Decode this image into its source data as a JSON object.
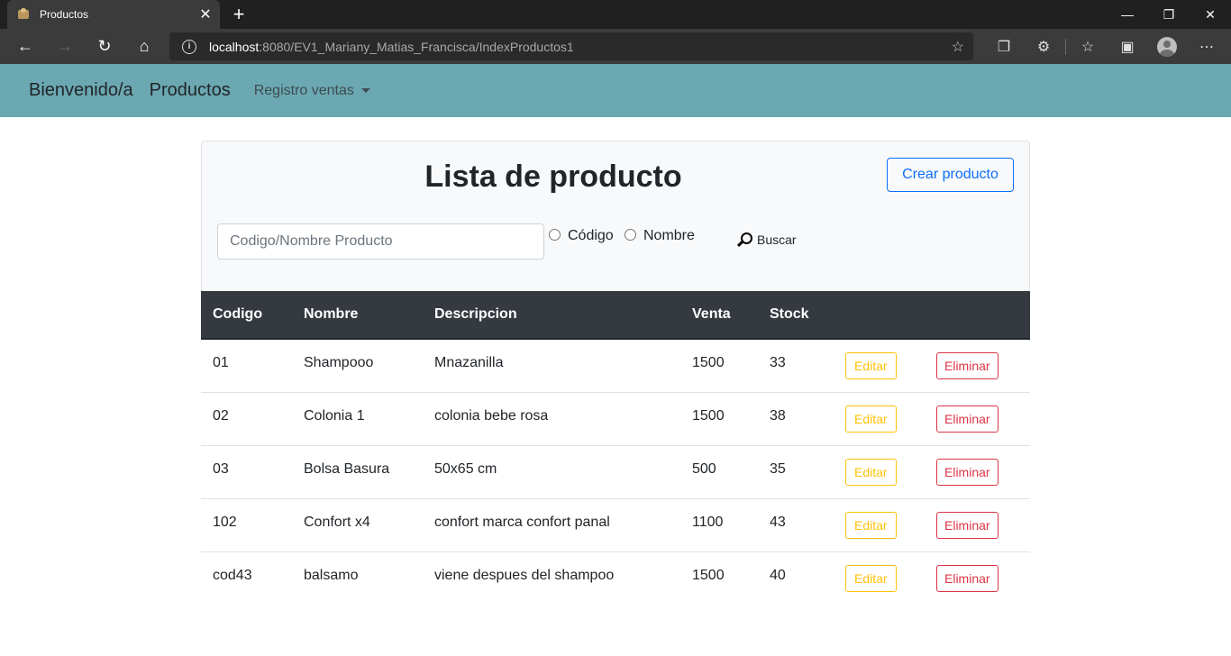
{
  "browser": {
    "tab_title": "Productos",
    "url_host": "localhost",
    "url_path": ":8080/EV1_Mariany_Matias_Francisca/IndexProductos1"
  },
  "navbar": {
    "brand": "Bienvenido/a",
    "link_products": "Productos",
    "dropdown_label": "Registro ventas"
  },
  "card": {
    "title": "Lista de producto",
    "create_button": "Crear producto",
    "search_placeholder": "Codigo/Nombre Producto",
    "radio_code": "Código",
    "radio_name": "Nombre",
    "search_button": "Buscar"
  },
  "table": {
    "headers": [
      "Codigo",
      "Nombre",
      "Descripcion",
      "Venta",
      "Stock"
    ],
    "edit_label": "Editar",
    "delete_label": "Eliminar",
    "rows": [
      {
        "codigo": "01",
        "nombre": "Shampooo",
        "descripcion": "Mnazanilla",
        "venta": "1500",
        "stock": "33"
      },
      {
        "codigo": "02",
        "nombre": "Colonia 1",
        "descripcion": "colonia bebe rosa",
        "venta": "1500",
        "stock": "38"
      },
      {
        "codigo": "03",
        "nombre": "Bolsa Basura",
        "descripcion": "50x65 cm",
        "venta": "500",
        "stock": "35"
      },
      {
        "codigo": "102",
        "nombre": "Confort x4",
        "descripcion": "confort marca confort panal",
        "venta": "1100",
        "stock": "43"
      },
      {
        "codigo": "cod43",
        "nombre": "balsamo",
        "descripcion": "viene despues del shampoo",
        "venta": "1500",
        "stock": "40"
      }
    ]
  },
  "colors": {
    "navbar_bg": "#6ba8b2",
    "table_header_bg": "#343a40",
    "primary": "#0d6efd",
    "warning": "#ffc107",
    "danger": "#dc3545"
  }
}
